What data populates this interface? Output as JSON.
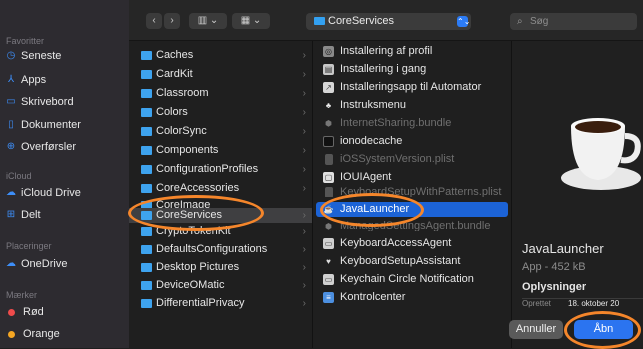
{
  "toolbar": {
    "back": "‹",
    "forward": "›",
    "view": "▥ ⌄",
    "group": "▦ ⌄",
    "path_label": "CoreServices",
    "path_chevron": "⌃⌄",
    "search_placeholder": "Søg",
    "search_icon": "⌕"
  },
  "sidebar": {
    "favorites_label": "Favoritter",
    "favorites": [
      {
        "label": "Seneste",
        "icon": "clock-icon",
        "glyph": "◷"
      },
      {
        "label": "Apps",
        "icon": "apps-icon",
        "glyph": "⅄"
      },
      {
        "label": "Skrivebord",
        "icon": "desktop-icon",
        "glyph": "▭"
      },
      {
        "label": "Dokumenter",
        "icon": "document-icon",
        "glyph": "▯"
      },
      {
        "label": "Overførsler",
        "icon": "download-icon",
        "glyph": "⊕"
      }
    ],
    "icloud_label": "iCloud",
    "icloud": [
      {
        "label": "iCloud Drive",
        "icon": "cloud-icon",
        "glyph": "☁"
      },
      {
        "label": "Delt",
        "icon": "shared-folder-icon",
        "glyph": "⊞"
      }
    ],
    "locations_label": "Placeringer",
    "locations": [
      {
        "label": "OneDrive",
        "icon": "cloud-icon",
        "glyph": "☁"
      }
    ],
    "tags_label": "Mærker",
    "tags": [
      {
        "label": "Rød",
        "color": "#ef4b4b"
      },
      {
        "label": "Orange",
        "color": "#f5a623"
      }
    ]
  },
  "column1": [
    {
      "label": "Caches"
    },
    {
      "label": "CardKit"
    },
    {
      "label": "Classroom"
    },
    {
      "label": "Colors"
    },
    {
      "label": "ColorSync"
    },
    {
      "label": "Components"
    },
    {
      "label": "ConfigurationProfiles"
    },
    {
      "label": "CoreAccessories"
    },
    {
      "label": "CoreImage"
    },
    {
      "label": "CoreServices"
    },
    {
      "label": "CryptoTokenKit"
    },
    {
      "label": "DefaultsConfigurations"
    },
    {
      "label": "Desktop Pictures"
    },
    {
      "label": "DeviceOMatic"
    },
    {
      "label": "DifferentialPrivacy"
    }
  ],
  "column2": [
    {
      "label": "Installering af profil",
      "icon": "app-icon",
      "dim": false
    },
    {
      "label": "Installering i gang",
      "icon": "app-icon",
      "dim": false
    },
    {
      "label": "Installeringsapp til Automator",
      "icon": "app-icon",
      "dim": false
    },
    {
      "label": "Instruksmenu",
      "icon": "app-icon",
      "dim": false
    },
    {
      "label": "InternetSharing.bundle",
      "icon": "bundle-icon",
      "dim": true
    },
    {
      "label": "ionodecache",
      "icon": "terminal-icon",
      "dim": false
    },
    {
      "label": "iOSSystemVersion.plist",
      "icon": "file-icon",
      "dim": true
    },
    {
      "label": "IOUIAgent",
      "icon": "app-icon",
      "dim": false
    },
    {
      "label": "KeyboardSetupWithPatterns.plist",
      "icon": "file-icon",
      "dim": true
    },
    {
      "label": "JavaLauncher",
      "icon": "app-icon",
      "dim": false
    },
    {
      "label": "ManagedSettingsAgent.bundle",
      "icon": "bundle-icon",
      "dim": true
    },
    {
      "label": "KeyboardAccessAgent",
      "icon": "app-icon",
      "dim": false
    },
    {
      "label": "KeyboardSetupAssistant",
      "icon": "app-icon",
      "dim": false
    },
    {
      "label": "Keychain Circle Notification",
      "icon": "app-icon",
      "dim": false
    },
    {
      "label": "Kontrolcenter",
      "icon": "app-icon",
      "dim": false
    }
  ],
  "preview": {
    "name": "JavaLauncher",
    "kind": "App - 452 kB",
    "info_label": "Oplysninger",
    "created_label": "Oprettet",
    "created_value": "18. oktober 20"
  },
  "buttons": {
    "cancel": "Annuller",
    "open": "Åbn"
  }
}
